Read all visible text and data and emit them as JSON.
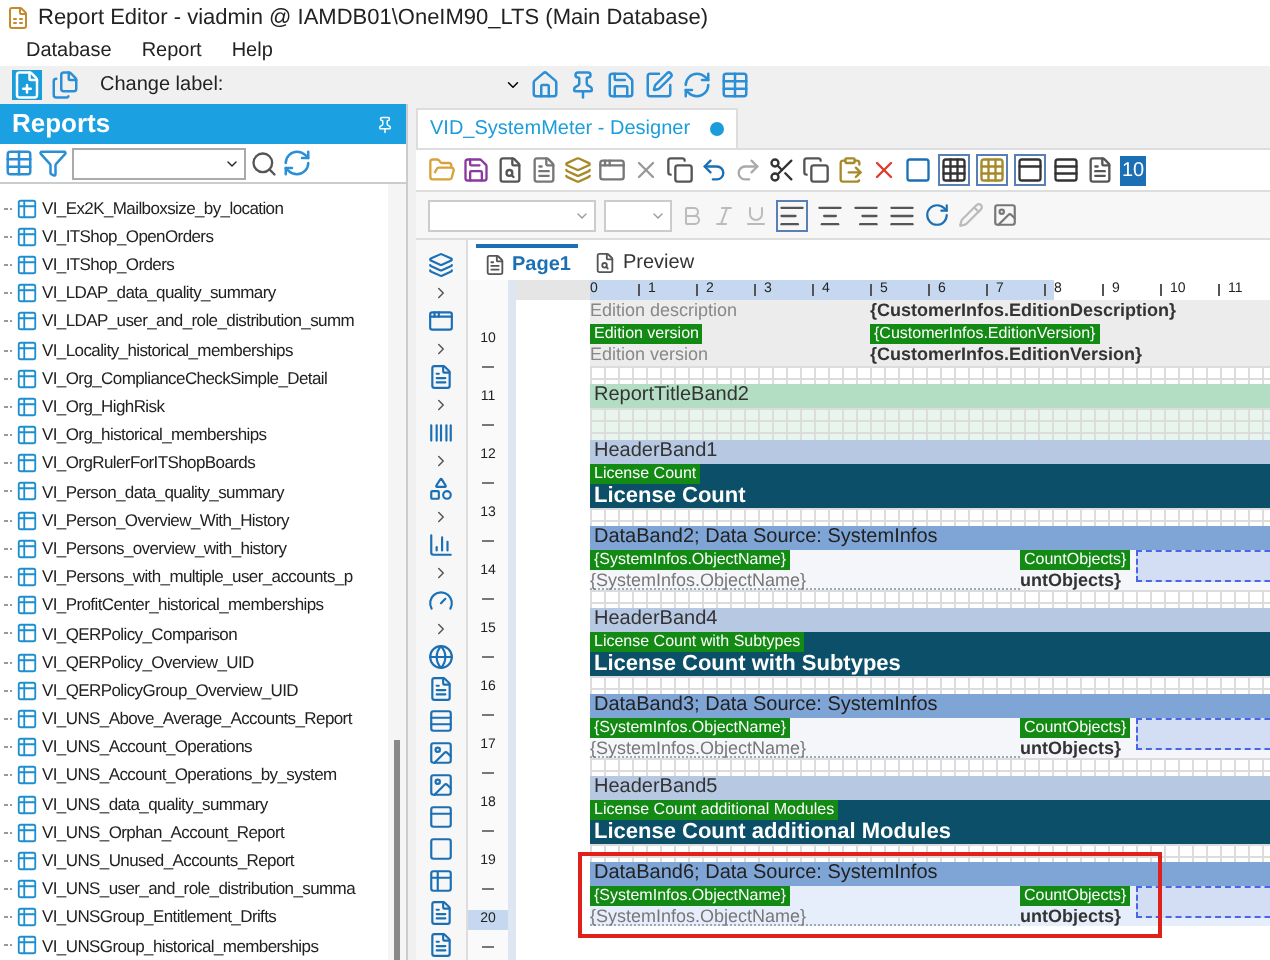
{
  "window": {
    "title": "Report Editor - viadmin @ IAMDB01\\OneIM90_LTS (Main Database)"
  },
  "menu": [
    "Database",
    "Report",
    "Help"
  ],
  "toolbar": {
    "label": "Change label:"
  },
  "reports": {
    "title": "Reports",
    "items": [
      "VI_Ex2K_Mailboxsize_by_location",
      "VI_ITShop_OpenOrders",
      "VI_ITShop_Orders",
      "VI_LDAP_data_quality_summary",
      "VI_LDAP_user_and_role_distribution_summ",
      "VI_Locality_historical_memberships",
      "VI_Org_ComplianceCheckSimple_Detail",
      "VI_Org_HighRisk",
      "VI_Org_historical_memberships",
      "VI_OrgRulerForITShopBoards",
      "VI_Person_data_quality_summary",
      "VI_Person_Overview_With_History",
      "VI_Persons_overview_with_history",
      "VI_Persons_with_multiple_user_accounts_p",
      "VI_ProfitCenter_historical_memberships",
      "VI_QERPolicy_Comparison",
      "VI_QERPolicy_Overview_UID",
      "VI_QERPolicyGroup_Overview_UID",
      "VI_UNS_Above_Average_Accounts_Report",
      "VI_UNS_Account_Operations",
      "VI_UNS_Account_Operations_by_system",
      "VI_UNS_data_quality_summary",
      "VI_UNS_Orphan_Account_Report",
      "VI_UNS_Unused_Accounts_Report",
      "VI_UNS_user_and_role_distribution_summa",
      "VI_UNSGroup_Entitlement_Drifts",
      "VI_UNSGroup_historical_memberships"
    ]
  },
  "designer": {
    "tab": "VID_SystemMeter - Designer",
    "zoom": "10",
    "page_tabs": [
      {
        "label": "Page1",
        "selected": true
      },
      {
        "label": "Preview",
        "selected": false
      }
    ],
    "ruler": [
      {
        "label": "0",
        "in_page": true
      },
      {
        "label": "1",
        "in_page": true
      },
      {
        "label": "2",
        "in_page": true
      },
      {
        "label": "3",
        "in_page": true
      },
      {
        "label": "4",
        "in_page": true
      },
      {
        "label": "5",
        "in_page": true
      },
      {
        "label": "6",
        "in_page": true
      },
      {
        "label": "7",
        "in_page": true
      },
      {
        "label": "8",
        "in_page": false
      },
      {
        "label": "9",
        "in_page": false
      },
      {
        "label": "10",
        "in_page": false
      },
      {
        "label": "11",
        "in_page": false
      }
    ],
    "vruler": [
      {
        "label": "10",
        "selected": false
      },
      {
        "label": "11",
        "selected": false
      },
      {
        "label": "12",
        "selected": false
      },
      {
        "label": "13",
        "selected": false
      },
      {
        "label": "14",
        "selected": false
      },
      {
        "label": "15",
        "selected": false
      },
      {
        "label": "16",
        "selected": false
      },
      {
        "label": "17",
        "selected": false
      },
      {
        "label": "18",
        "selected": false
      },
      {
        "label": "19",
        "selected": false
      },
      {
        "label": "20",
        "selected": true
      }
    ],
    "bands": [
      {
        "kind": "fields",
        "left_text": "Edition description",
        "right_text": "{CustomerInfos.EditionDescription}"
      },
      {
        "kind": "fields",
        "left_tag": "Edition version",
        "left_text": "Edition version",
        "right_tag": "{CustomerInfos.EditionVersion}",
        "right_text": "{CustomerInfos.EditionVersion}"
      },
      {
        "kind": "spacer"
      },
      {
        "kind": "title_band",
        "label": "ReportTitleBand2"
      },
      {
        "kind": "header_band",
        "label": "HeaderBand1"
      },
      {
        "kind": "caption",
        "tag": "License Count",
        "title": "License Count"
      },
      {
        "kind": "spacer"
      },
      {
        "kind": "data_band",
        "label": "DataBand2; Data Source: SystemInfos",
        "highlighted": false,
        "left_tag": "{SystemInfos.ObjectName}",
        "left_text": "{SystemInfos.ObjectName}",
        "right_tag": "CountObjects}",
        "right_text": "untObjects}"
      },
      {
        "kind": "spacer"
      },
      {
        "kind": "header_band",
        "label": "HeaderBand4"
      },
      {
        "kind": "caption",
        "tag": "License Count with Subtypes",
        "title": "License Count with Subtypes"
      },
      {
        "kind": "spacer"
      },
      {
        "kind": "data_band",
        "label": "DataBand3; Data Source: SystemInfos",
        "highlighted": false,
        "left_tag": "{SystemInfos.ObjectName}",
        "left_text": "{SystemInfos.ObjectName}",
        "right_tag": "CountObjects}",
        "right_text": "untObjects}"
      },
      {
        "kind": "spacer"
      },
      {
        "kind": "header_band",
        "label": "HeaderBand5"
      },
      {
        "kind": "caption",
        "tag": "License Count additional Modules",
        "title": "License Count additional Modules"
      },
      {
        "kind": "spacer"
      },
      {
        "kind": "data_band",
        "label": "DataBand6; Data Source: SystemInfos",
        "highlighted": true,
        "left_tag": "{SystemInfos.ObjectName}",
        "left_text": "{SystemInfos.ObjectName}",
        "right_tag": "CountObjects}",
        "right_text": "untObjects}"
      }
    ]
  }
}
